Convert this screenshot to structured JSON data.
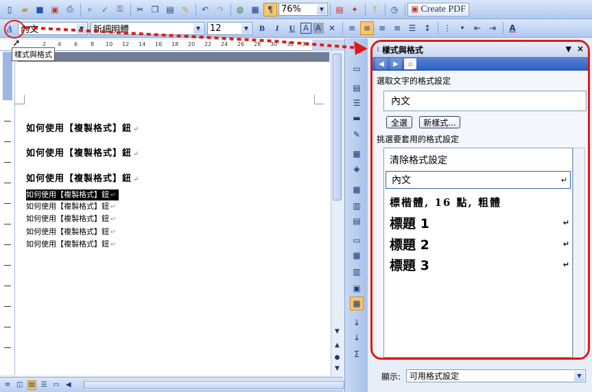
{
  "toolbar_standard": {
    "zoom_value": "76%",
    "create_pdf_label": "Create PDF"
  },
  "toolbar_formatting": {
    "style_value": "內文",
    "font_value": "新細明體",
    "size_value": "12",
    "bold_label": "B",
    "italic_label": "I",
    "underline_label": "U",
    "font_color_label": "A"
  },
  "tooltip": "樣式與格式",
  "ruler": {
    "ticks": [
      "2",
      "4",
      "6",
      "8",
      "10",
      "12",
      "14",
      "16",
      "18",
      "20",
      "22",
      "24",
      "26",
      "28",
      "30",
      "32",
      "34",
      "36",
      "38"
    ]
  },
  "document": {
    "large_lines": [
      "如何使用【複製格式】鈕",
      "如何使用【複製格式】鈕",
      "如何使用【複製格式】鈕"
    ],
    "small_lines": [
      "如何使用【複製格式】鈕",
      "如何使用【複製格式】鈕",
      "如何使用【複製格式】鈕",
      "如何使用【複製格式】鈕",
      "如何使用【複製格式】鈕"
    ],
    "paragraph_mark": "↵"
  },
  "task_pane": {
    "title": "樣式與格式",
    "selected_text_label": "選取文字的格式設定",
    "current_style": "內文",
    "select_all_button": "全選",
    "new_style_button": "新樣式...",
    "apply_label": "挑選要套用的格式設定",
    "styles": [
      {
        "label": "清除格式設定",
        "return_mark": ""
      },
      {
        "label": "內文",
        "return_mark": "↵"
      },
      {
        "label": "標楷體, 16 點, 粗體",
        "return_mark": ""
      },
      {
        "label": "標題 1",
        "return_mark": "↵"
      },
      {
        "label": "標題 2",
        "return_mark": "↵"
      },
      {
        "label": "標題 3",
        "return_mark": "↵"
      }
    ],
    "show_label": "顯示:",
    "show_value": "可用格式設定"
  },
  "colors": {
    "highlight": "#e01818",
    "toolbar": "#b0c8ee",
    "selection": "#000000"
  }
}
